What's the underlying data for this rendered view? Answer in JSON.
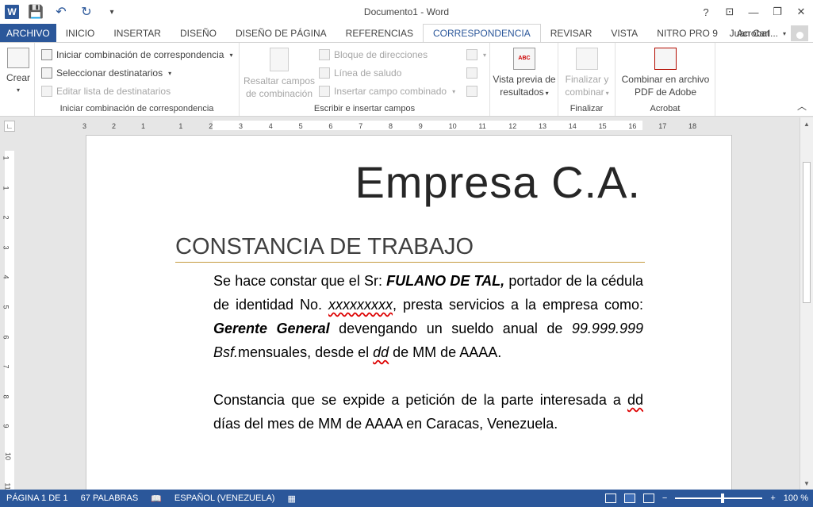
{
  "titlebar": {
    "title": "Documento1 - Word",
    "help": "?",
    "minimize": "—",
    "restore": "❐",
    "close": "✕"
  },
  "tabs": [
    {
      "label": "ARCHIVO"
    },
    {
      "label": "INICIO"
    },
    {
      "label": "INSERTAR"
    },
    {
      "label": "DISEÑO"
    },
    {
      "label": "DISEÑO DE PÁGINA"
    },
    {
      "label": "REFERENCIAS"
    },
    {
      "label": "CORRESPONDENCIA"
    },
    {
      "label": "REVISAR"
    },
    {
      "label": "VISTA"
    },
    {
      "label": "NITRO PRO 9"
    },
    {
      "label": "Acrobat"
    }
  ],
  "user": {
    "name": "Juan Carl..."
  },
  "ribbon": {
    "crear": "Crear",
    "iniciar": "Iniciar combinación de correspondencia",
    "seleccionar": "Seleccionar destinatarios",
    "editar": "Editar lista de destinatarios",
    "group1": "Iniciar combinación de correspondencia",
    "resaltar1": "Resaltar campos",
    "resaltar2": "de combinación",
    "bloque": "Bloque de direcciones",
    "linea": "Línea de saludo",
    "insertar": "Insertar campo combinado",
    "group2": "Escribir e insertar campos",
    "vista1": "Vista previa de",
    "vista2": "resultados",
    "finalizar1": "Finalizar y",
    "finalizar2": "combinar",
    "group3": "Finalizar",
    "combinar1": "Combinar en archivo",
    "combinar2": "PDF de Adobe",
    "group4": "Acrobat"
  },
  "ruler": {
    "h": [
      "3",
      "2",
      "1",
      "1",
      "2",
      "3",
      "4",
      "5",
      "6",
      "7",
      "8",
      "9",
      "10",
      "11",
      "12",
      "13",
      "14",
      "15",
      "16",
      "17",
      "18"
    ],
    "v": [
      "1",
      "1",
      "2",
      "3",
      "4",
      "5",
      "6",
      "7",
      "8",
      "9",
      "10",
      "11"
    ]
  },
  "document": {
    "company": "Empresa C.A.",
    "heading": "CONSTANCIA DE TRABAJO",
    "p1_a": "Se hace constar que el Sr: ",
    "p1_name": "FULANO DE TAL,",
    "p1_b": " portador de la cédula de identidad No. ",
    "p1_id": "xxxxxxxxx",
    "p1_c": ", presta servicios a la empresa como: ",
    "p1_role": "Gerente General",
    "p1_d": " devengando un sueldo anual de ",
    "p1_amount": "99.999.999 Bsf.",
    "p1_e": "mensuales, desde el ",
    "p1_dd": "dd",
    "p1_f": " de MM de AAAA.",
    "p2_a": "Constancia que se expide a petición de la parte interesada a ",
    "p2_dd": "dd",
    "p2_b": " días del mes de MM de AAAA en Caracas, Venezuela."
  },
  "status": {
    "page": "PÁGINA 1 DE 1",
    "words": "67 PALABRAS",
    "language": "ESPAÑOL (VENEZUELA)",
    "zoom": "100 %",
    "zoom_out": "−",
    "zoom_in": "+"
  }
}
